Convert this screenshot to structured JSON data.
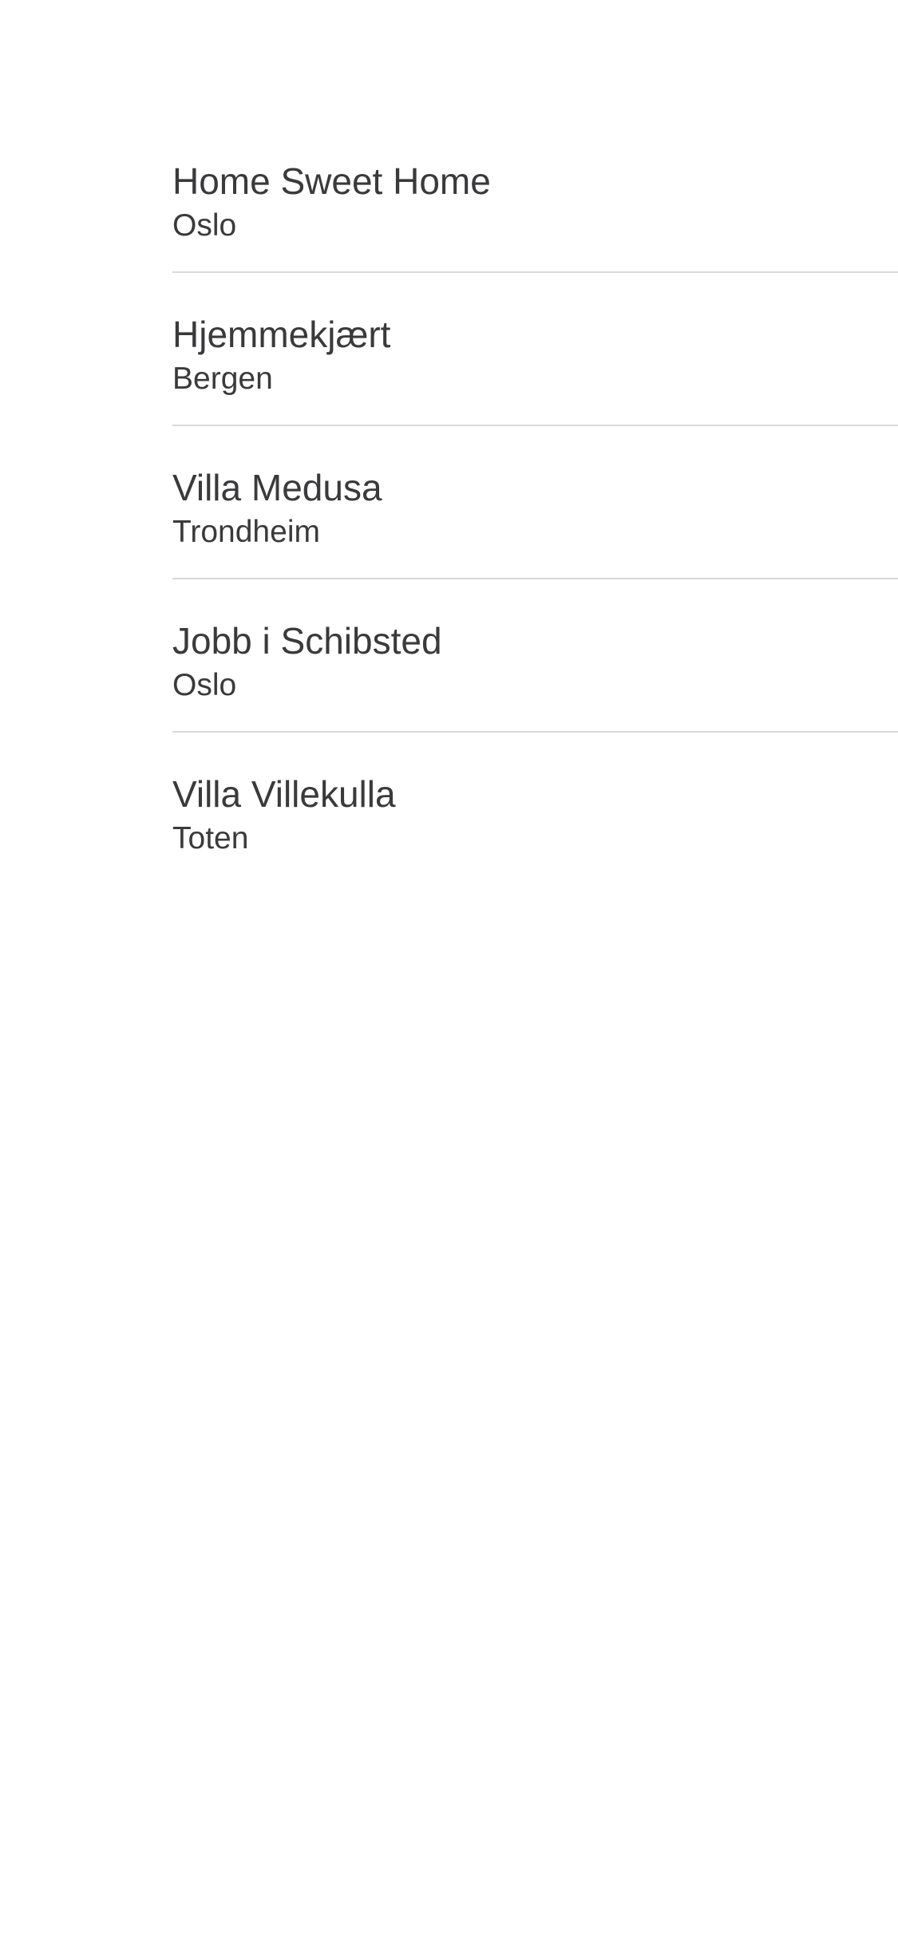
{
  "list": {
    "items": [
      {
        "title": "Home Sweet Home",
        "subtitle": "Oslo"
      },
      {
        "title": "Hjemmekjært",
        "subtitle": "Bergen"
      },
      {
        "title": "Villa Medusa",
        "subtitle": "Trondheim"
      },
      {
        "title": "Jobb i Schibsted",
        "subtitle": "Oslo"
      },
      {
        "title": "Villa Villekulla",
        "subtitle": "Toten"
      }
    ]
  }
}
